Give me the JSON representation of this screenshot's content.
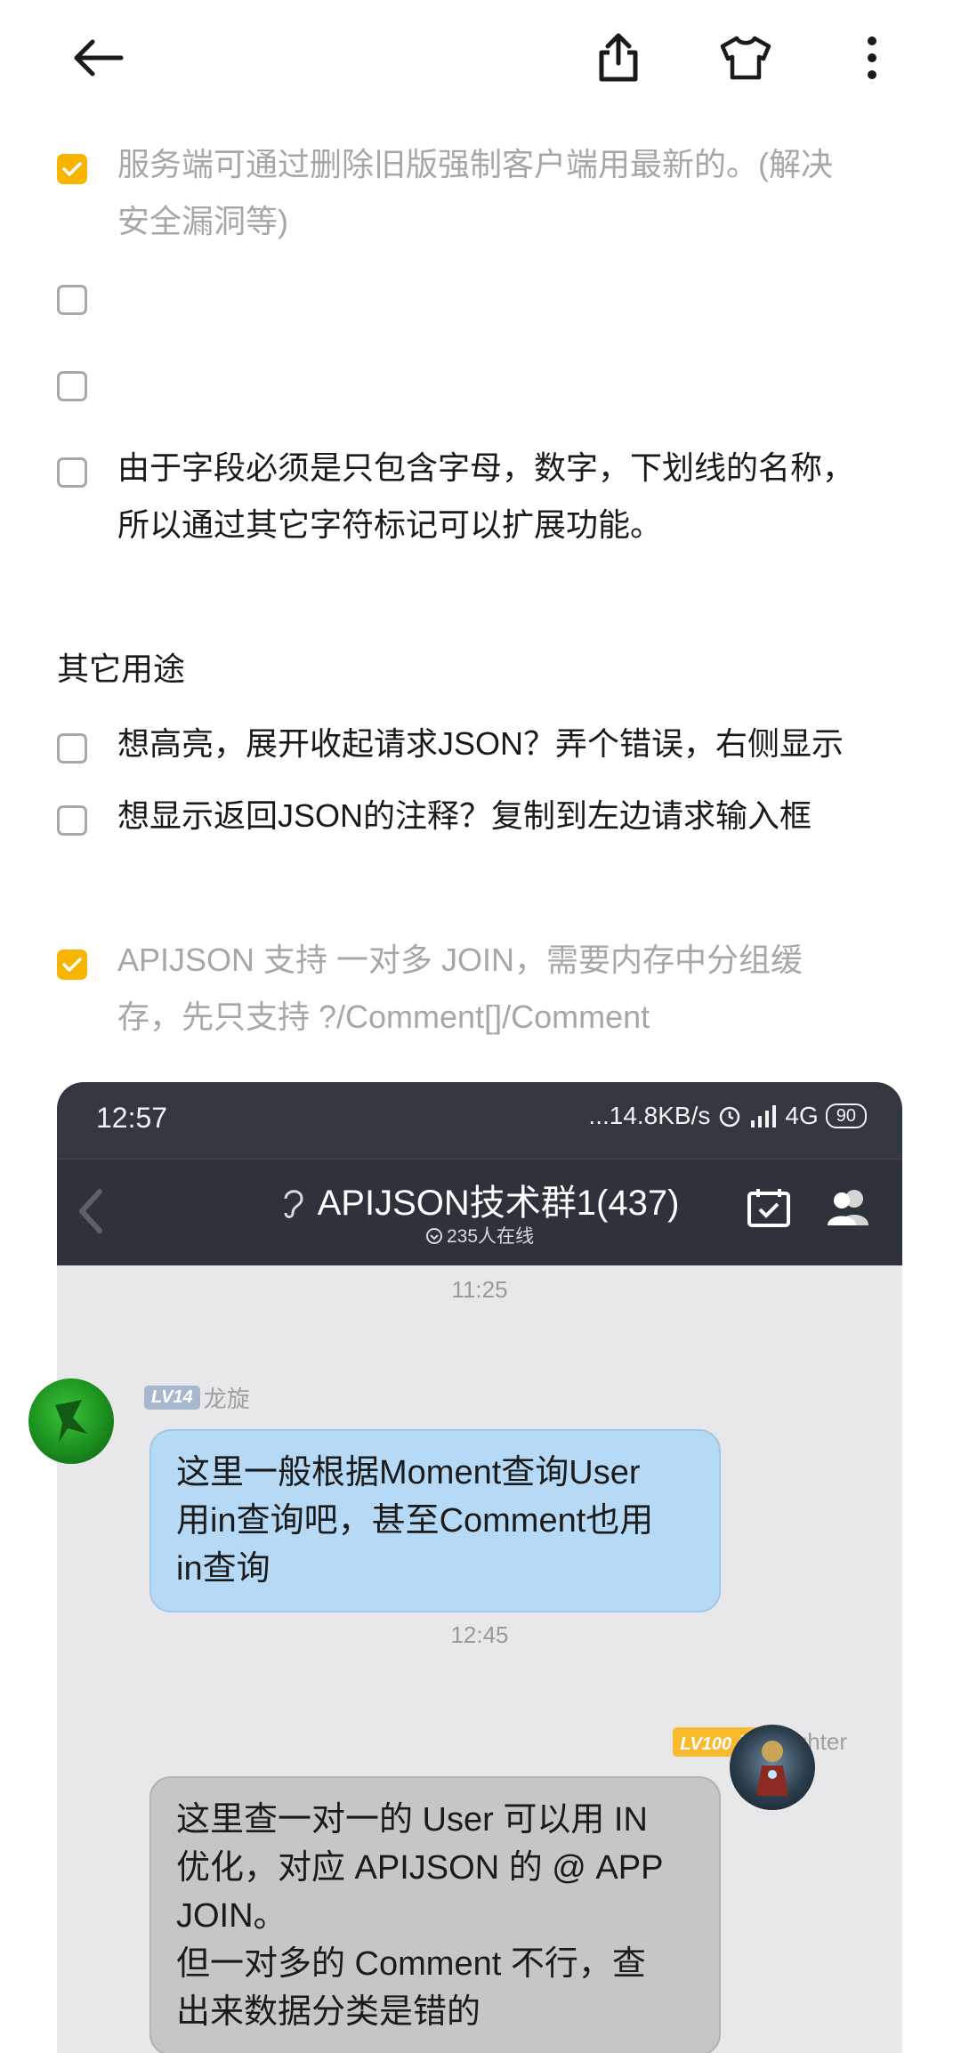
{
  "toolbar": {
    "back": "arrow-left-icon",
    "share": "share-icon",
    "skin": "tshirt-icon",
    "more": "more-vertical-icon"
  },
  "colors": {
    "accent": "#f7b500",
    "done_text": "#a7a7a7"
  },
  "tasks_top": [
    {
      "checked": true,
      "lines": [
        "服务端可通过删除旧版强制客户端用最新的。(解决",
        "安全漏洞等)"
      ]
    },
    {
      "checked": false,
      "lines": []
    },
    {
      "checked": false,
      "lines": []
    },
    {
      "checked": false,
      "lines": [
        "由于字段必须是只包含字母，数字，下划线的名称，",
        "所以通过其它字符标记可以扩展功能。"
      ]
    }
  ],
  "section_title": "其它用途",
  "tasks_mid": [
    {
      "checked": false,
      "text": "想高亮，展开收起请求JSON？弄个错误，右侧显示"
    },
    {
      "checked": false,
      "text": "想显示返回JSON的注释？复制到左边请求输入框"
    }
  ],
  "task_join": {
    "checked": true,
    "lines": [
      "APIJSON 支持 一对多 JOIN，需要内存中分组缓",
      "存，先只支持 ?/Comment[]/Comment"
    ]
  },
  "screenshot": {
    "status_time": "12:57",
    "status_speed": "...14.8KB/s",
    "network": "4G",
    "battery": "90",
    "chat_title": "APIJSON技术群1(437)",
    "online": "235人在线",
    "time1": "11:25",
    "msg1": {
      "level": "LV14",
      "name": "龙旋",
      "lines": [
        "这里一般根据Moment查询User",
        "用in查询吧，甚至Comment也用",
        "in查询"
      ]
    },
    "time2": "12:45",
    "msg2": {
      "level": "LV100 群主",
      "name": "fighter",
      "lines": [
        "这里查一对一的 User 可以用 IN",
        "优化，对应 APIJSON 的 @ APP",
        "JOIN。",
        "但一对多的 Comment 不行，查",
        "出来数据分类是错的"
      ]
    }
  }
}
